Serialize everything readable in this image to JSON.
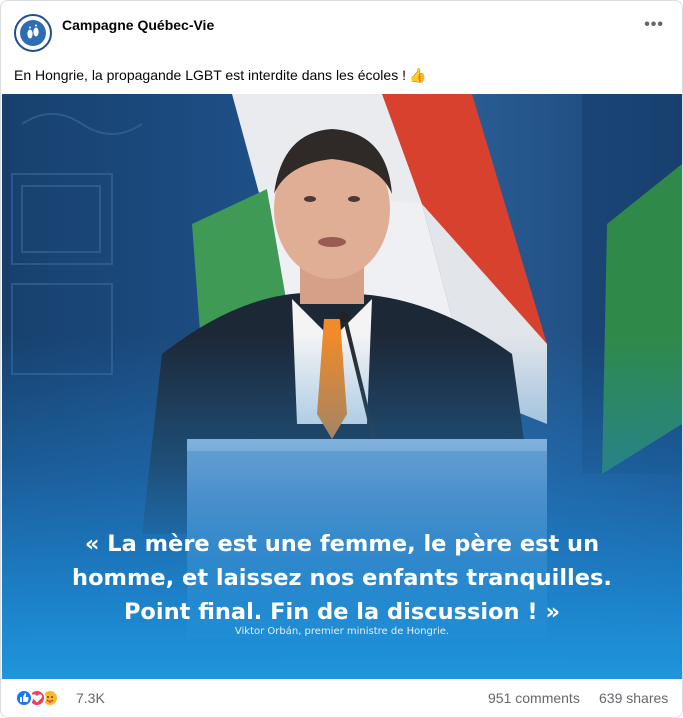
{
  "post": {
    "author": "Campagne Québec-Vie",
    "more_icon": "more-horizontal-icon",
    "caption": "En Hongrie, la propagande LGBT est interdite dans les écoles !",
    "caption_emoji": "👍",
    "image": {
      "quote_line1": "« La mère est une femme, le père est un",
      "quote_line2": "homme, et laissez nos enfants tranquilles.",
      "quote_line3": "Point final. Fin de la discussion ! »",
      "attribution": "Viktor Orbán, premier ministre de Hongrie."
    }
  },
  "footer": {
    "reactions": [
      "like-reaction-icon",
      "love-reaction-icon",
      "care-reaction-icon"
    ],
    "reaction_count": "7.3K",
    "comments": "951 comments",
    "shares": "639 shares"
  },
  "colors": {
    "brand_blue": "#1877f2",
    "love_red": "#f33e58",
    "care_yellow": "#f7b928",
    "secondary_text": "#65676b"
  }
}
